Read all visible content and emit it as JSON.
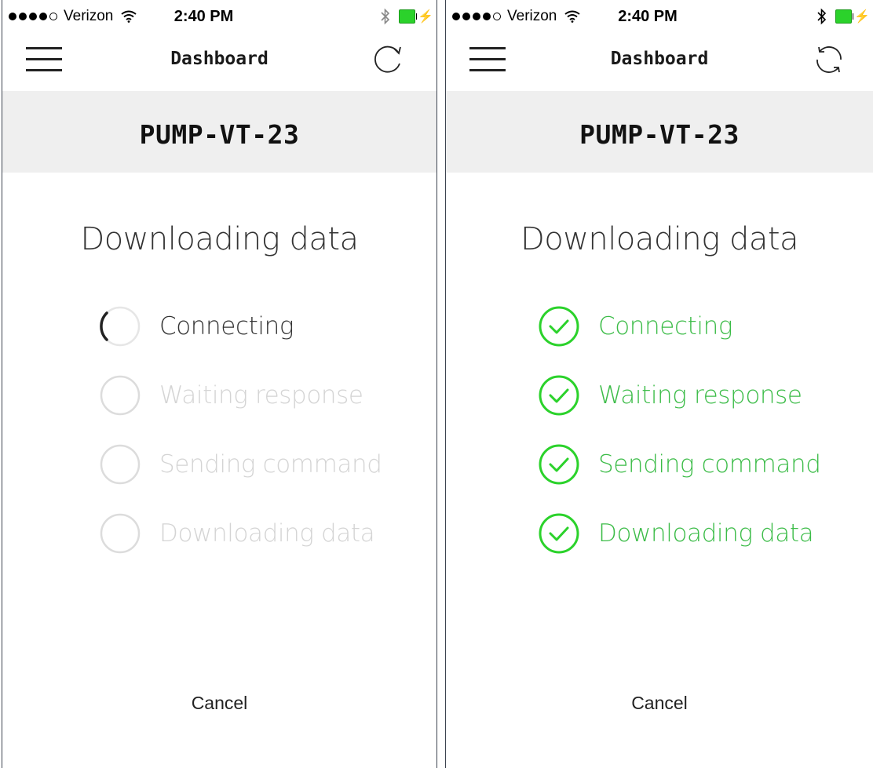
{
  "screens": [
    {
      "status_bar": {
        "carrier": "Verizon",
        "time": "2:40 PM"
      },
      "nav": {
        "title": "Dashboard"
      },
      "device": {
        "name": "PUMP-VT-23"
      },
      "heading": "Downloading data",
      "steps": [
        {
          "label": "Connecting",
          "state": "in-progress"
        },
        {
          "label": "Waiting response",
          "state": "pending"
        },
        {
          "label": "Sending command",
          "state": "pending"
        },
        {
          "label": "Downloading data",
          "state": "pending"
        }
      ],
      "cancel_label": "Cancel"
    },
    {
      "status_bar": {
        "carrier": "Verizon",
        "time": "2:40 PM"
      },
      "nav": {
        "title": "Dashboard"
      },
      "device": {
        "name": "PUMP-VT-23"
      },
      "heading": "Downloading data",
      "steps": [
        {
          "label": "Connecting",
          "state": "complete"
        },
        {
          "label": "Waiting response",
          "state": "complete"
        },
        {
          "label": "Sending command",
          "state": "complete"
        },
        {
          "label": "Downloading data",
          "state": "complete"
        }
      ],
      "cancel_label": "Cancel"
    }
  ],
  "colors": {
    "success_green": "#2bd22b",
    "success_text": "#3cbc48",
    "pending_gray": "#d4d4d4",
    "band_gray": "#efefef",
    "battery_green": "#2bd22b"
  },
  "icons": {
    "menu": "hamburger-menu-icon",
    "refresh": "refresh-icon",
    "spinner": "loading-spinner-icon",
    "pending": "empty-circle-icon",
    "complete": "check-circle-icon",
    "wifi": "wifi-icon",
    "bluetooth": "bluetooth-icon",
    "battery": "battery-icon"
  }
}
